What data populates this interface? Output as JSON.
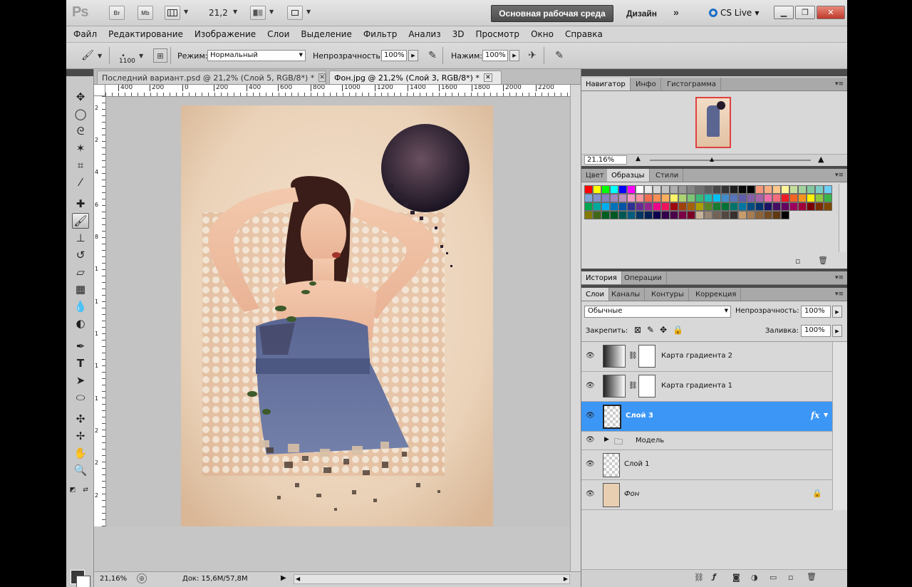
{
  "appbar": {
    "logo": "Ps",
    "bridge": "Br",
    "minibridge": "Mb",
    "zoom": "21,2",
    "workspace_active": "Основная рабочая среда",
    "workspace_design": "Дизайн",
    "workspace_more": "»",
    "cs_live": "CS Live"
  },
  "menu": [
    "Файл",
    "Редактирование",
    "Изображение",
    "Слои",
    "Выделение",
    "Фильтр",
    "Анализ",
    "3D",
    "Просмотр",
    "Окно",
    "Справка"
  ],
  "options": {
    "brush_size": "1100",
    "mode_label": "Режим:",
    "mode_value": "Нормальный",
    "opacity_label": "Непрозрачность:",
    "opacity_value": "100%",
    "flow_label": "Нажим:",
    "flow_value": "100%"
  },
  "tabs": [
    {
      "label": "Последний вариант.psd @ 21,2% (Слой 5, RGB/8*) *",
      "active": false
    },
    {
      "label": "Фон.jpg @ 21,2% (Слой 3, RGB/8*) *",
      "active": true
    }
  ],
  "ruler_h": [
    "400",
    "200",
    "0",
    "200",
    "400",
    "600",
    "800",
    "1000",
    "1200",
    "1400",
    "1600",
    "1800",
    "2000",
    "2200"
  ],
  "ruler_v": [
    "2",
    "2",
    "4",
    "6",
    "8",
    "1",
    "1",
    "1",
    "1",
    "1",
    "2",
    "2",
    "2",
    "2",
    "2",
    "3",
    "3"
  ],
  "status": {
    "zoom": "21,16%",
    "doc": "Док: 15,6M/57,8M"
  },
  "navigator": {
    "tabs": [
      "Навигатор",
      "Инфо",
      "Гистограмма"
    ],
    "zoom": "21.16%"
  },
  "swatches_tabs": [
    "Цвет",
    "Образцы",
    "Стили"
  ],
  "history_tabs": [
    "История",
    "Операции"
  ],
  "layers_tabs": [
    "Слои",
    "Каналы",
    "Контуры",
    "Коррекция"
  ],
  "layers_panel": {
    "blend": "Обычные",
    "opacity_label": "Непрозрачность:",
    "opacity": "100%",
    "lock_label": "Закрепить:",
    "fill_label": "Заливка:",
    "fill": "100%"
  },
  "layers": [
    {
      "name": "Карта градиента 2"
    },
    {
      "name": "Карта градиента 1"
    },
    {
      "name": "Слой 3",
      "fx": "fx"
    },
    {
      "name": "Модель"
    },
    {
      "name": "Слой 1"
    },
    {
      "name": "Фон"
    }
  ],
  "colors": {
    "selection": "#3b96f5",
    "panel": "#d8d8d8",
    "chrome": "#c8c8c8"
  }
}
